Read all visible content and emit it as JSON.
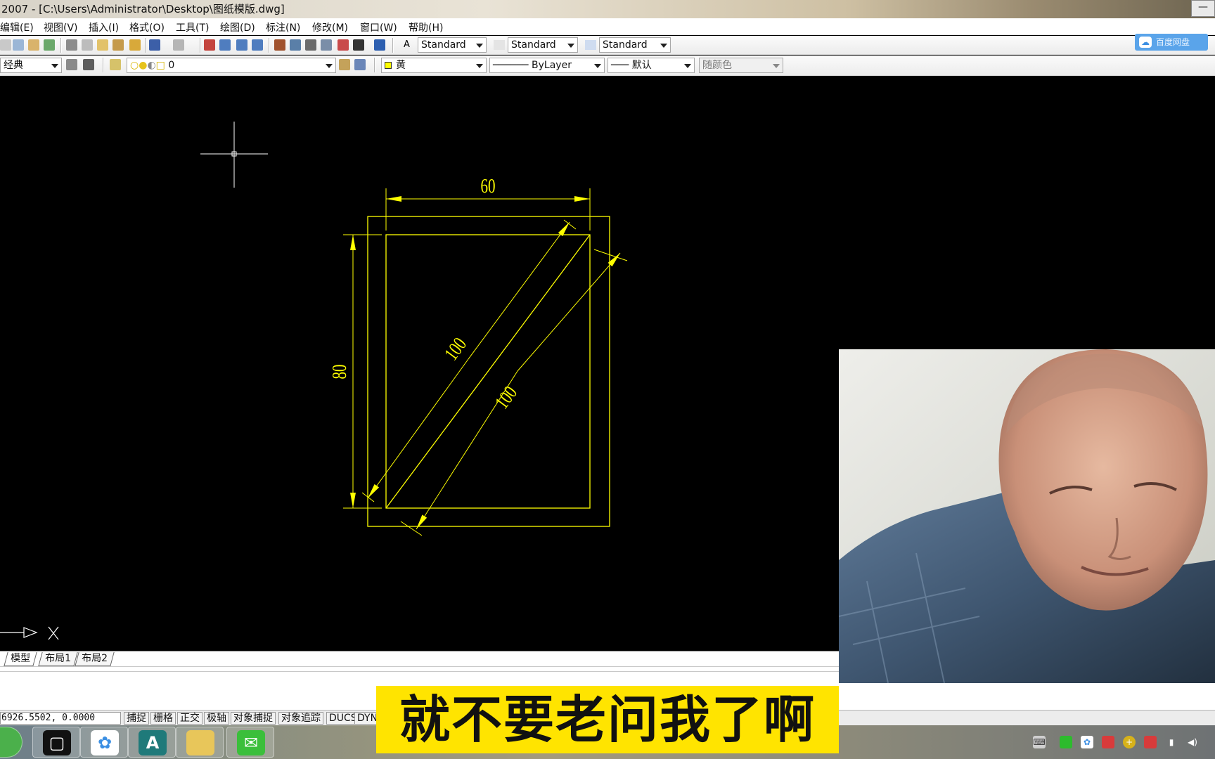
{
  "window": {
    "title": "2007 - [C:\\Users\\Administrator\\Desktop\\图纸模版.dwg]",
    "minimize_glyph": "—"
  },
  "menu": [
    "编辑(E)",
    "视图(V)",
    "插入(I)",
    "格式(O)",
    "工具(T)",
    "绘图(D)",
    "标注(N)",
    "修改(M)",
    "窗口(W)",
    "帮助(H)"
  ],
  "toolbar": {
    "text_style": "Standard",
    "dim_style": "Standard",
    "table_style": "Standard",
    "workspace": "经典",
    "layer": "0",
    "color": "黄",
    "linetype": "ByLayer",
    "lineweight": "默认",
    "plot_style": "随颜色"
  },
  "cloud_button": {
    "label": "百度网盘",
    "icon": "baidu-cloud-icon"
  },
  "drawing": {
    "accent_color": "#ffff00",
    "dim_top": "60",
    "dim_left": "80",
    "dim_diag_inner": "100",
    "dim_diag_outer": "100",
    "ucs_x_label": "X"
  },
  "layout_tabs": [
    "模型",
    "布局1",
    "布局2"
  ],
  "status": {
    "coords": "6926.5502, 0.0000",
    "toggles": [
      "捕捉",
      "栅格",
      "正交",
      "极轴",
      "对象捕捉",
      "对象追踪",
      "DUCS",
      "DYN"
    ]
  },
  "subtitle": "就不要老问我了啊",
  "taskbar": {
    "apps": [
      "start-icon",
      "video-recorder-icon",
      "baidu-netdisk-icon",
      "autocad-icon",
      "file-explorer-icon",
      "wechat-icon"
    ],
    "tray": [
      "keyboard-icon",
      "wechat-tray-icon",
      "netdisk-tray-icon",
      "record-tray-icon",
      "security-tray-icon",
      "usb-tray-icon",
      "network-icon",
      "volume-icon"
    ]
  }
}
